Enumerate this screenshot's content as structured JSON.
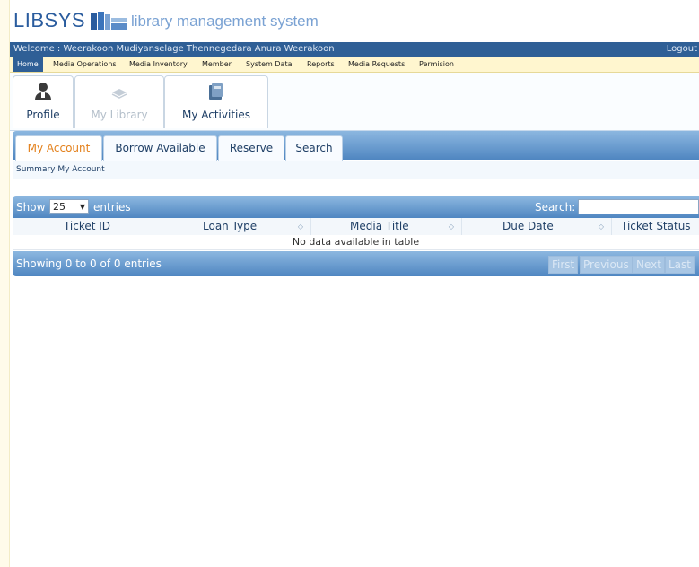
{
  "header": {
    "logo": "LIBSYS",
    "tagline": "library management system",
    "welcome": "Welcome : Weerakoon Mudiyanselage Thennegedara Anura Weerakoon",
    "logout": "Logout"
  },
  "menu": {
    "items": [
      {
        "label": "Home",
        "active": true
      },
      {
        "label": "Media Operations"
      },
      {
        "label": "Media Inventory"
      },
      {
        "label": "Member"
      },
      {
        "label": "System Data"
      },
      {
        "label": "Reports"
      },
      {
        "label": "Media Requests"
      },
      {
        "label": "Permision"
      }
    ]
  },
  "modules": [
    {
      "label": "Profile",
      "icon": "user-icon"
    },
    {
      "label": "My Library",
      "icon": "books-icon",
      "disabled": true
    },
    {
      "label": "My Activities",
      "icon": "activities-icon"
    }
  ],
  "subtabs": [
    {
      "label": "My Account",
      "active": true
    },
    {
      "label": "Borrow Available"
    },
    {
      "label": "Reserve"
    },
    {
      "label": "Search"
    }
  ],
  "summary": "Summary My Account",
  "table": {
    "show_label": "Show",
    "page_length": "25",
    "entries_label": "entries",
    "search_label": "Search:",
    "search_value": "",
    "columns": [
      "Ticket ID",
      "Loan Type",
      "Media Title",
      "Due Date",
      "Ticket Status"
    ],
    "empty_message": "No data available in table",
    "info": "Showing 0 to 0 of 0 entries",
    "pager": [
      "First",
      "Previous",
      "Next",
      "Last"
    ]
  },
  "colors": {
    "accent": "#2f5f96",
    "active_tab_text": "#e3801b",
    "menu_bg": "#fff6cf"
  }
}
